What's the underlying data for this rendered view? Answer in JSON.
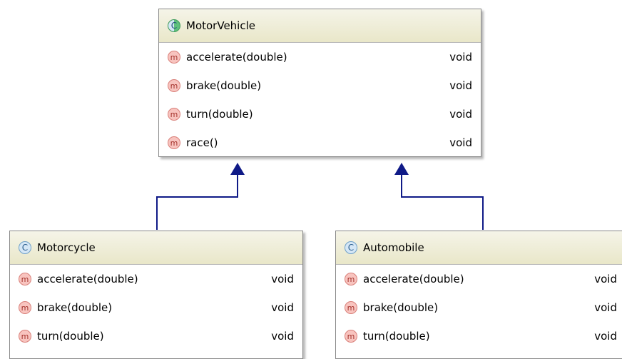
{
  "parent": {
    "name": "MotorVehicle",
    "methods": [
      {
        "name": "accelerate(double)",
        "type": "void"
      },
      {
        "name": "brake(double)",
        "type": "void"
      },
      {
        "name": "turn(double)",
        "type": "void"
      },
      {
        "name": "race()",
        "type": "void"
      }
    ]
  },
  "children": [
    {
      "name": "Motorcycle",
      "methods": [
        {
          "name": "accelerate(double)",
          "type": "void"
        },
        {
          "name": "brake(double)",
          "type": "void"
        },
        {
          "name": "turn(double)",
          "type": "void"
        }
      ]
    },
    {
      "name": "Automobile",
      "methods": [
        {
          "name": "accelerate(double)",
          "type": "void"
        },
        {
          "name": "brake(double)",
          "type": "void"
        },
        {
          "name": "turn(double)",
          "type": "void"
        }
      ]
    }
  ],
  "icons": {
    "class_letter": "C",
    "method_letter": "m"
  },
  "colors": {
    "arrow": "#0f1a87",
    "header": "#eeeed5",
    "border": "#8a8a8a"
  }
}
